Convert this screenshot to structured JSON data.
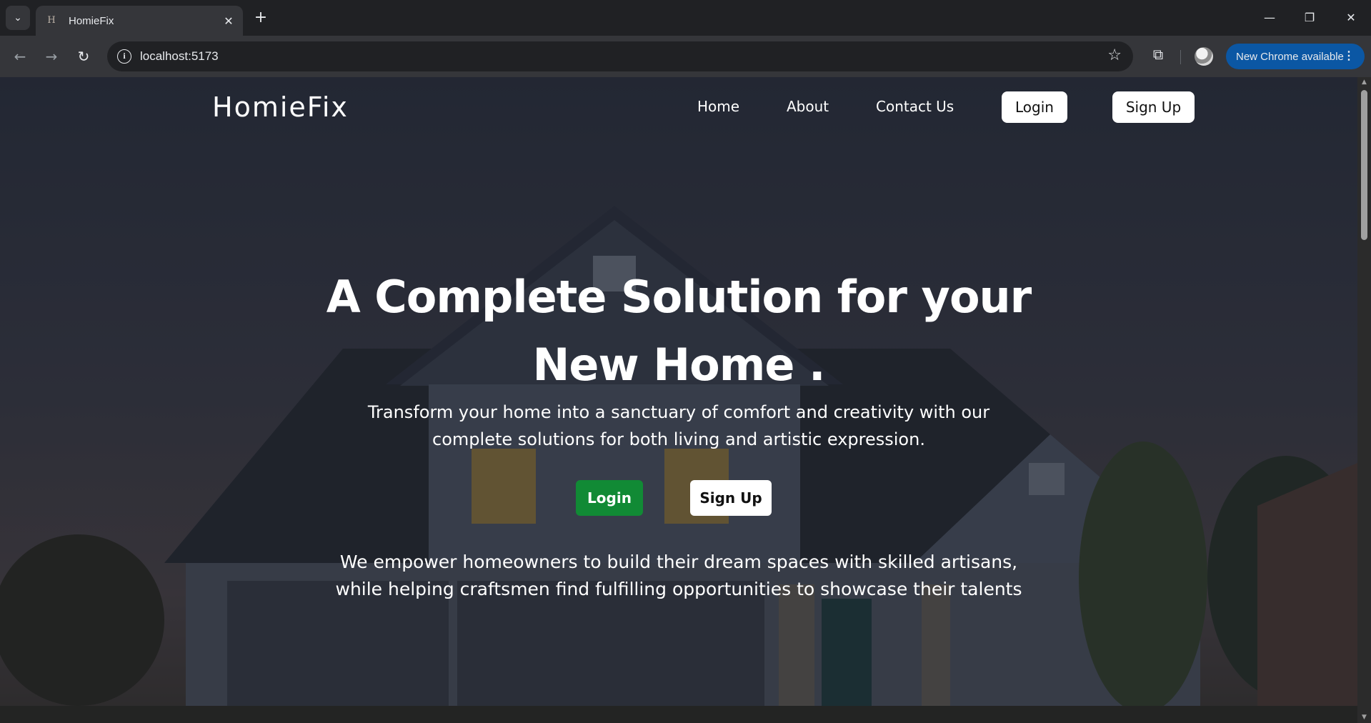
{
  "browser": {
    "tab_title": "HomieFix",
    "tab_favicon": "homiefix-favicon",
    "url": "localhost:5173",
    "update_label": "New Chrome available",
    "icons": [
      "tab-search-icon",
      "close-icon",
      "new-tab-icon",
      "minimize-icon",
      "restore-icon",
      "window-close-icon",
      "back-icon",
      "forward-icon",
      "reload-icon",
      "site-info-icon",
      "bookmark-star-icon",
      "extensions-icon",
      "profile-avatar",
      "menu-dots-icon"
    ]
  },
  "site": {
    "brand": "HomieFix",
    "nav": {
      "home": "Home",
      "about": "About",
      "contact": "Contact Us",
      "login": "Login",
      "signup": "Sign Up"
    },
    "hero": {
      "title_line1": "A Complete Solution for your",
      "title_line2": "New Home .",
      "subtitle_line1": "Transform your home into a sanctuary of comfort and creativity with our",
      "subtitle_line2": "complete solutions for both living and artistic expression.",
      "login_label": "Login",
      "signup_label": "Sign Up",
      "mission_line1": "We empower homeowners to build their dream spaces with skilled artisans,",
      "mission_line2": "while helping craftsmen find fulfilling opportunities to showcase their talents"
    },
    "background": "house-at-dusk-photo"
  },
  "colors": {
    "login_button": "#118a35",
    "signup_button": "#ffffff",
    "nav_pill": "#ffffff",
    "update_pill": "#0b57a4",
    "chrome_dark": "#202124",
    "chrome_toolbar": "#35363a"
  }
}
